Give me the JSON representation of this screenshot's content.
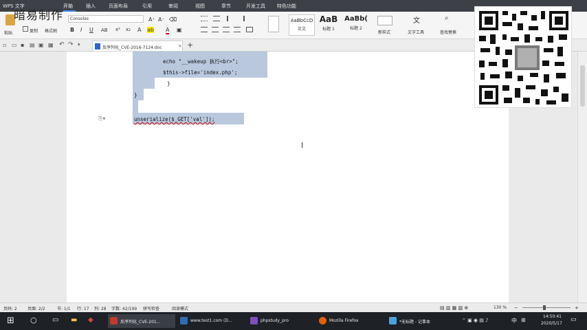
{
  "menubar": {
    "app_name": "WPS 文字",
    "tabs": [
      {
        "label": "开始"
      },
      {
        "label": "插入"
      },
      {
        "label": "页面布局"
      },
      {
        "label": "引用"
      },
      {
        "label": "审阅"
      },
      {
        "label": "视图"
      },
      {
        "label": "章节"
      },
      {
        "label": "开发工具"
      },
      {
        "label": "特色功能"
      }
    ]
  },
  "ribbon": {
    "paste": "粘贴",
    "copy": "复制",
    "format_painter": "格式刷",
    "font_name": "Consolas",
    "styles": [
      {
        "sample": "AaBbCcD",
        "name": "正文"
      },
      {
        "sample": "AaB",
        "name": "标题 1"
      },
      {
        "sample": "AaBb(",
        "name": "标题 2"
      }
    ],
    "new_style": "新样式",
    "text_tools": "文字工具",
    "find_replace": "查找替换"
  },
  "document": {
    "tab_title": "反序列化_CVE-2016-7124.doc",
    "code_lines": [
      "echo \"__wakeup 执行<br>\";",
      "$this->file='index.php';",
      "}",
      "}",
      "unserialize($_GET['val']);"
    ]
  },
  "watermark": "暗易制作",
  "statusbar": {
    "page": "页码: 2",
    "pages": "页面: 2/2",
    "section": "节: 1/1",
    "row": "行: 17",
    "col": "列: 28",
    "words": "字数: 42/199",
    "spell": "拼写检查",
    "mode": "阅读模式",
    "zoom": "130 %"
  },
  "taskbar": {
    "items": [
      {
        "label": "反序列化_CVE-201...",
        "color": "#c0392b"
      },
      {
        "label": "www.test1.com (D...",
        "color": "#2f6db5"
      },
      {
        "label": "phpstudy_pro",
        "color": "#7d4fbf"
      },
      {
        "label": "Mozilla Firefox",
        "color": "#e66000"
      },
      {
        "label": "*无标题 - 记事本",
        "color": "#4aa3df"
      }
    ],
    "ime": "中",
    "time": "14:50:41",
    "date": "2020/5/17"
  }
}
